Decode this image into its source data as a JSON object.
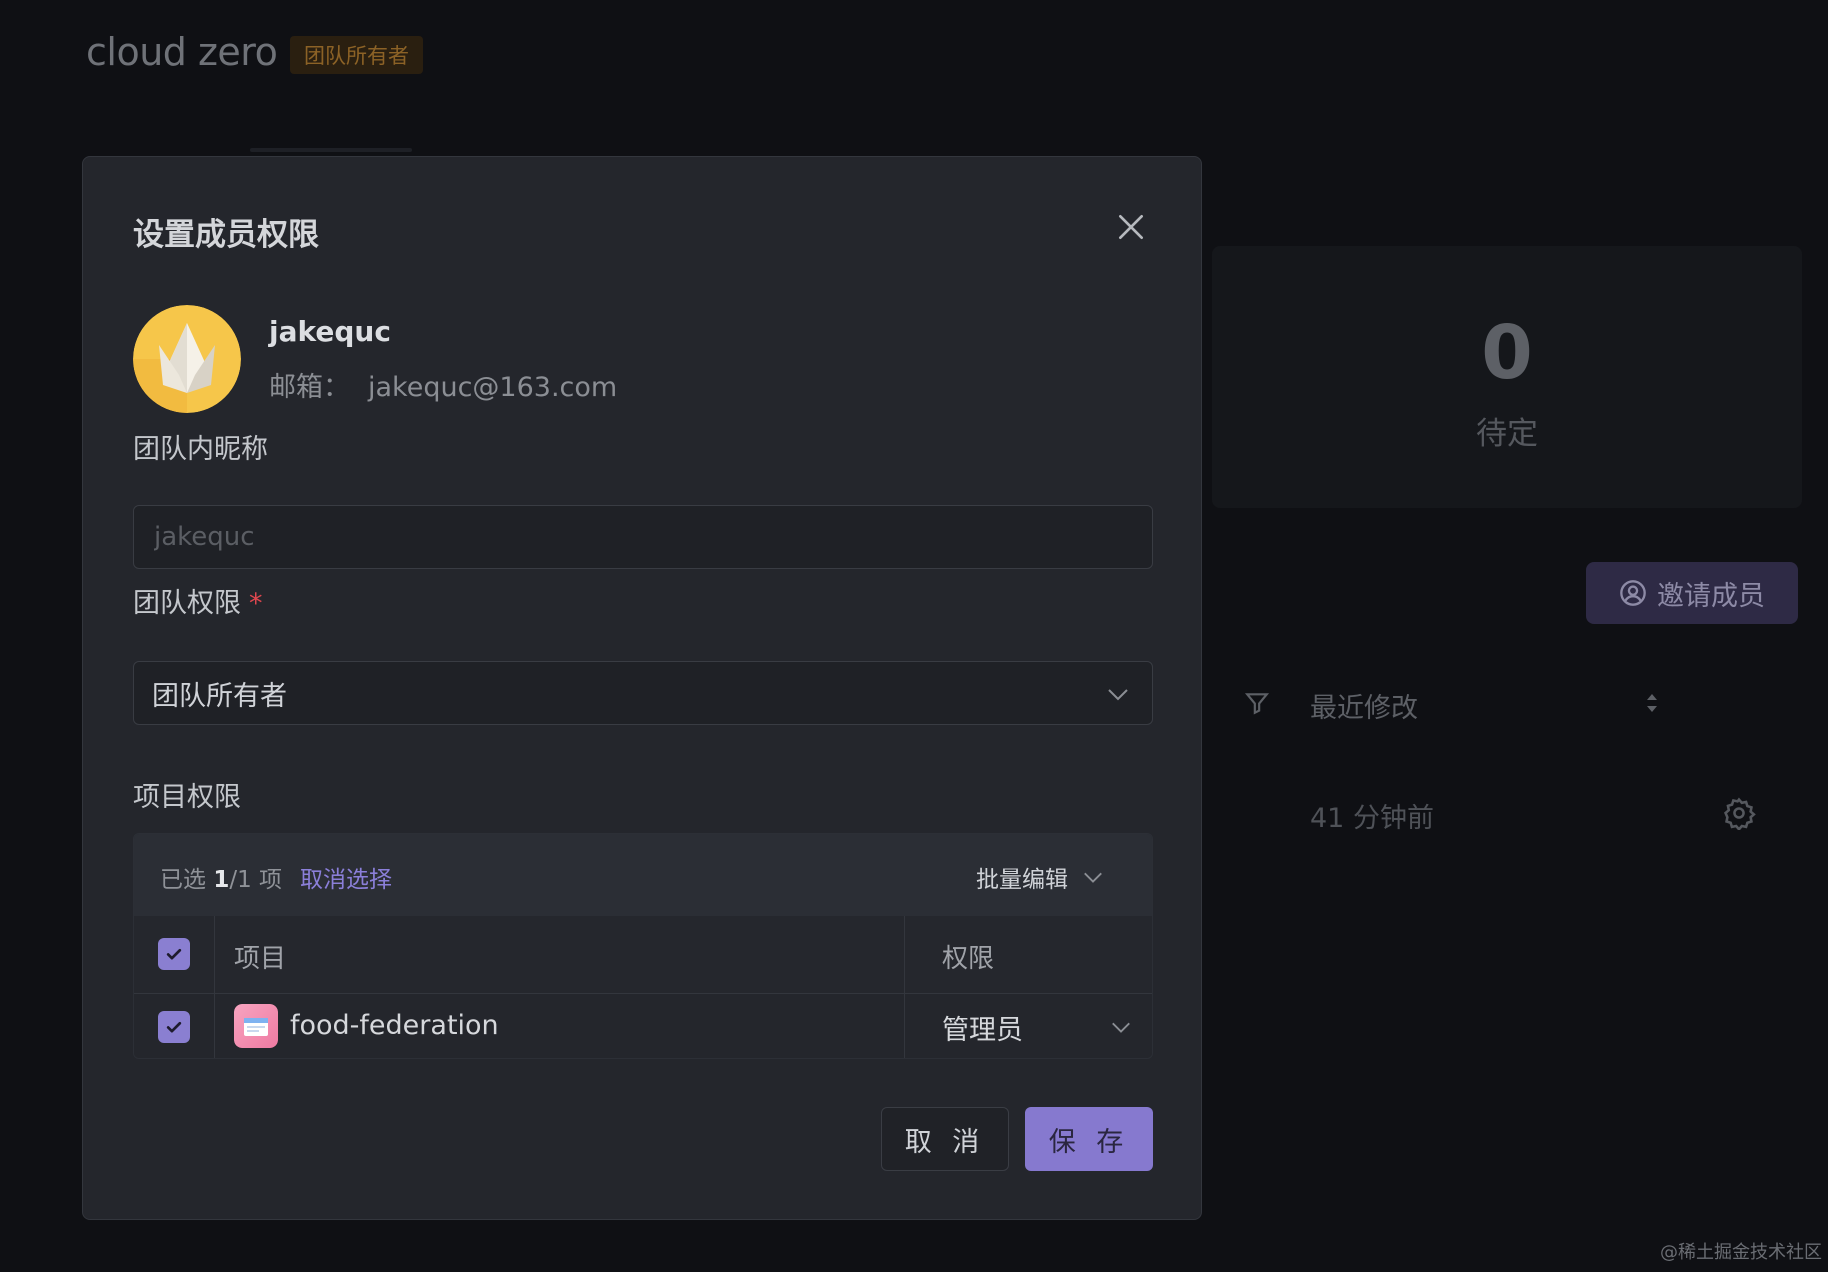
{
  "background": {
    "team_name": "cloud zero",
    "role_badge": "团队所有者",
    "stat": {
      "count": "0",
      "label": "待定"
    },
    "invite_button": "邀请成员",
    "table": {
      "col_recent": "最近修改",
      "row_time": "41 分钟前"
    },
    "watermark": "@稀土掘金技术社区"
  },
  "modal": {
    "title": "设置成员权限",
    "user": {
      "name": "jakequc",
      "email_label": "邮箱：",
      "email": "jakequc@163.com"
    },
    "nickname": {
      "label": "团队内昵称",
      "placeholder": "jakequc",
      "value": ""
    },
    "team_permission": {
      "label": "团队权限",
      "required_mark": "*",
      "selected": "团队所有者"
    },
    "project_permission": {
      "label": "项目权限",
      "selected_prefix": "已选",
      "selected_count": "1",
      "selected_total": "/1 项",
      "clear_selection": "取消选择",
      "batch_edit": "批量编辑",
      "columns": {
        "project": "项目",
        "permission": "权限"
      },
      "rows": [
        {
          "project": "food-federation",
          "permission": "管理员",
          "checked": true
        }
      ]
    },
    "buttons": {
      "cancel": "取 消",
      "save": "保 存"
    }
  },
  "colors": {
    "accent": "#8679cf",
    "modal_bg": "#24262c",
    "page_bg": "#0f1014",
    "required": "#e0474f"
  }
}
